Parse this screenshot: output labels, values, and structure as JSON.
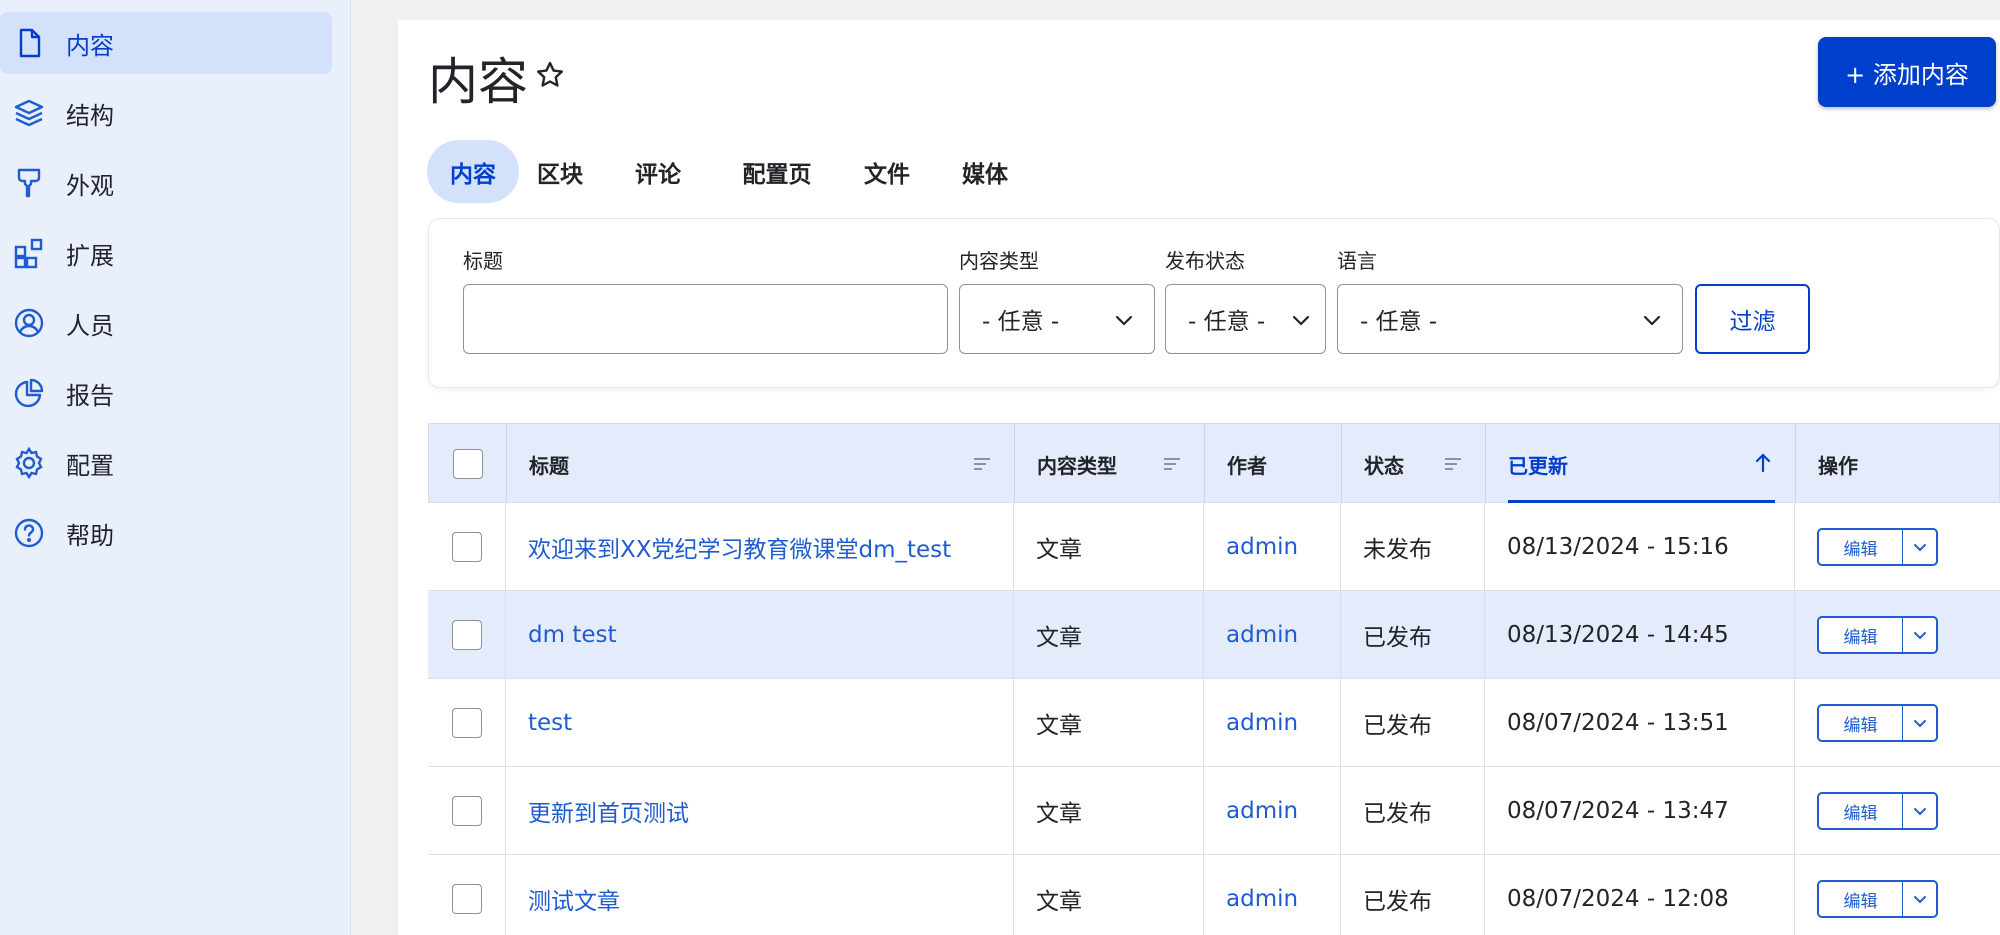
{
  "sidebar": {
    "items": [
      {
        "label": "内容",
        "icon": "file-icon",
        "active": true
      },
      {
        "label": "结构",
        "icon": "layers-icon",
        "active": false
      },
      {
        "label": "外观",
        "icon": "paint-roller-icon",
        "active": false
      },
      {
        "label": "扩展",
        "icon": "puzzle-icon",
        "active": false
      },
      {
        "label": "人员",
        "icon": "user-icon",
        "active": false
      },
      {
        "label": "报告",
        "icon": "pie-chart-icon",
        "active": false
      },
      {
        "label": "配置",
        "icon": "gear-icon",
        "active": false
      },
      {
        "label": "帮助",
        "icon": "help-icon",
        "active": false
      }
    ]
  },
  "header": {
    "title": "内容",
    "add_button": "+ 添加内容"
  },
  "tabs": [
    {
      "label": "内容",
      "active": true
    },
    {
      "label": "区块",
      "active": false
    },
    {
      "label": "评论",
      "active": false
    },
    {
      "label": "配置页",
      "active": false
    },
    {
      "label": "文件",
      "active": false
    },
    {
      "label": "媒体",
      "active": false
    }
  ],
  "filters": {
    "title_label": "标题",
    "title_value": "",
    "type_label": "内容类型",
    "type_value": "- 任意 -",
    "status_label": "发布状态",
    "status_value": "- 任意 -",
    "lang_label": "语言",
    "lang_value": "- 任意 -",
    "submit": "过滤"
  },
  "table": {
    "columns": [
      "标题",
      "内容类型",
      "作者",
      "状态",
      "已更新",
      "操作"
    ],
    "rows": [
      {
        "title": "欢迎来到XX党纪学习教育微课堂dm_test",
        "type": "文章",
        "author": "admin",
        "status": "未发布",
        "updated": "08/13/2024 - 15:16",
        "action": "编辑"
      },
      {
        "title": "dm test",
        "type": "文章",
        "author": "admin",
        "status": "已发布",
        "updated": "08/13/2024 - 14:45",
        "action": "编辑"
      },
      {
        "title": "test",
        "type": "文章",
        "author": "admin",
        "status": "已发布",
        "updated": "08/07/2024 - 13:51",
        "action": "编辑"
      },
      {
        "title": "更新到首页测试",
        "type": "文章",
        "author": "admin",
        "status": "已发布",
        "updated": "08/07/2024 - 13:47",
        "action": "编辑"
      },
      {
        "title": "测试文章",
        "type": "文章",
        "author": "admin",
        "status": "已发布",
        "updated": "08/07/2024 - 12:08",
        "action": "编辑"
      }
    ]
  },
  "colors": {
    "accent": "#003ecc",
    "link": "#1f5ccf",
    "sidebar_bg": "#e9f0fc",
    "active_bg": "#d4e1fb"
  }
}
